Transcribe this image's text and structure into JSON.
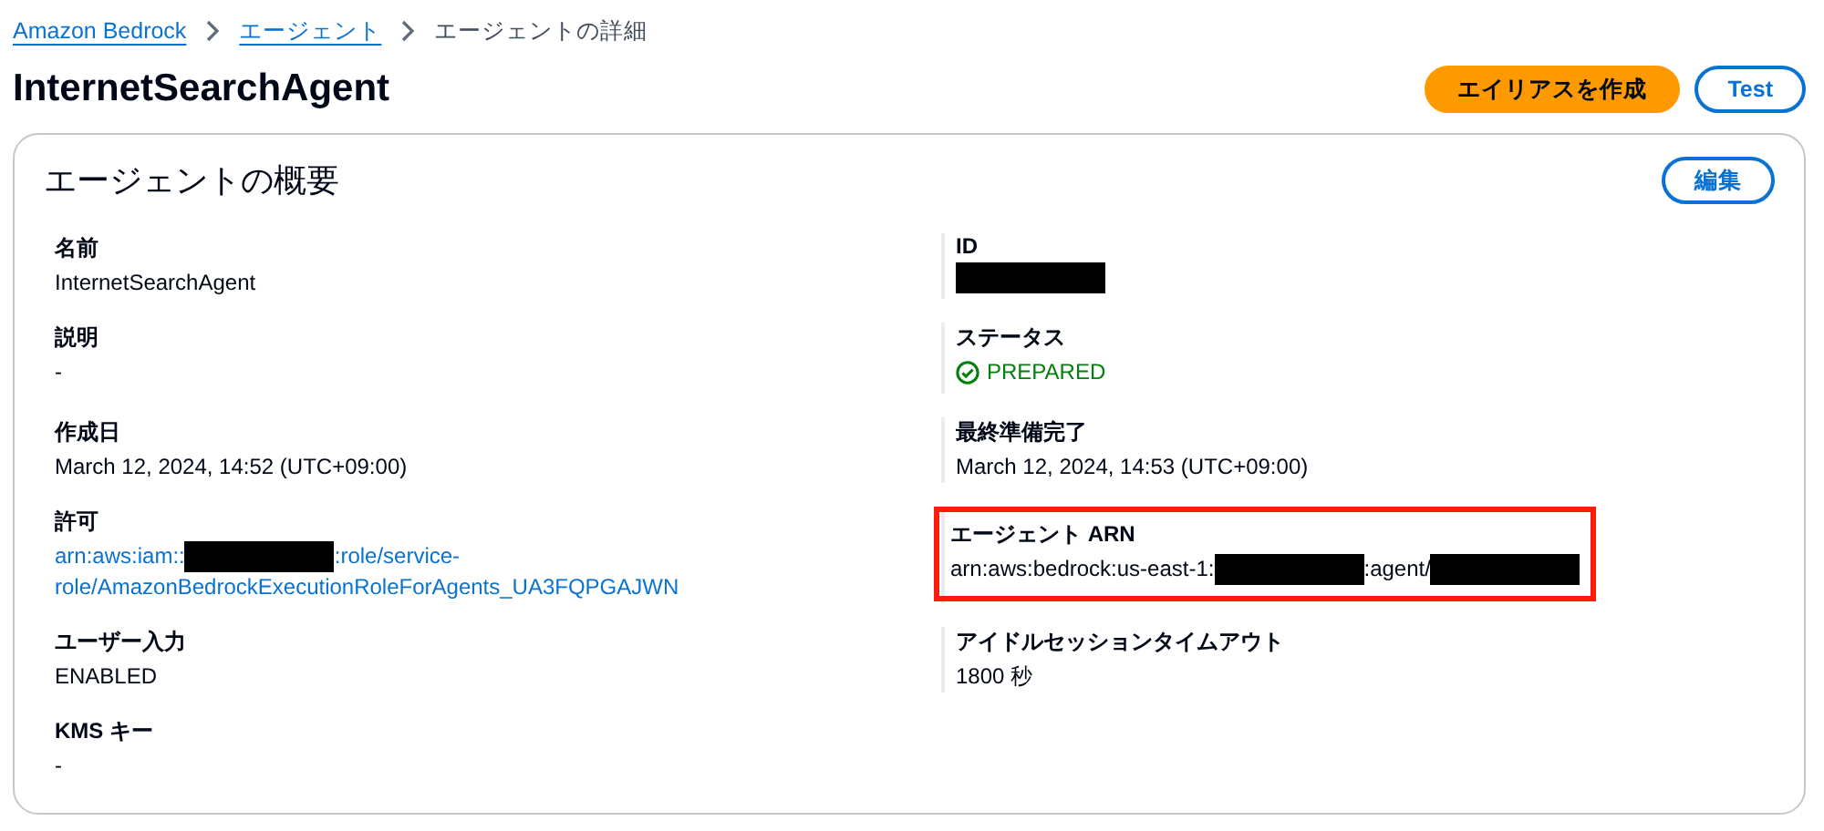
{
  "breadcrumbs": [
    {
      "label": "Amazon Bedrock",
      "link": true
    },
    {
      "label": "エージェント",
      "link": true
    },
    {
      "label": "エージェントの詳細",
      "link": false
    }
  ],
  "title": "InternetSearchAgent",
  "actions": [
    {
      "label": "エイリアスを作成",
      "kind": "primary"
    },
    {
      "label": "Test",
      "kind": "secondary"
    }
  ],
  "overview": {
    "title": "エージェントの概要",
    "edit_button": "編集",
    "columns": [
      [
        {
          "label": "名前",
          "parts": [
            {
              "kind": "text",
              "text": "InternetSearchAgent"
            }
          ]
        },
        {
          "label": "説明",
          "parts": [
            {
              "kind": "text",
              "text": "-"
            }
          ]
        },
        {
          "label": "作成日",
          "parts": [
            {
              "kind": "text",
              "text": "March 12, 2024, 14:52 (UTC+09:00)"
            }
          ]
        },
        {
          "label": "許可",
          "link": true,
          "parts": [
            {
              "kind": "text",
              "text": "arn:aws:iam::"
            },
            {
              "kind": "redacted"
            },
            {
              "kind": "text",
              "text": ":role/service-"
            },
            {
              "kind": "break"
            },
            {
              "kind": "text",
              "text": "role/AmazonBedrockExecutionRoleForAgents_UA3FQPGAJWN"
            }
          ]
        },
        {
          "label": "ユーザー入力",
          "parts": [
            {
              "kind": "text",
              "text": "ENABLED"
            }
          ]
        },
        {
          "label": "KMS キー",
          "parts": [
            {
              "kind": "text",
              "text": "-"
            }
          ]
        }
      ],
      [
        {
          "label": "ID",
          "parts": [
            {
              "kind": "redacted"
            }
          ]
        },
        {
          "label": "ステータス",
          "parts": [
            {
              "kind": "status",
              "text": "PREPARED"
            }
          ]
        },
        {
          "label": "最終準備完了",
          "parts": [
            {
              "kind": "text",
              "text": "March 12, 2024, 14:53 (UTC+09:00)"
            }
          ]
        },
        {
          "label": "エージェント ARN",
          "highlighted": true,
          "parts": [
            {
              "kind": "text",
              "text": "arn:aws:bedrock:us-east-1:"
            },
            {
              "kind": "redacted"
            },
            {
              "kind": "text",
              "text": ":agent/"
            },
            {
              "kind": "redacted"
            }
          ]
        },
        {
          "label": "アイドルセッションタイムアウト",
          "parts": [
            {
              "kind": "text",
              "text": "1800 秒"
            }
          ]
        }
      ]
    ]
  }
}
